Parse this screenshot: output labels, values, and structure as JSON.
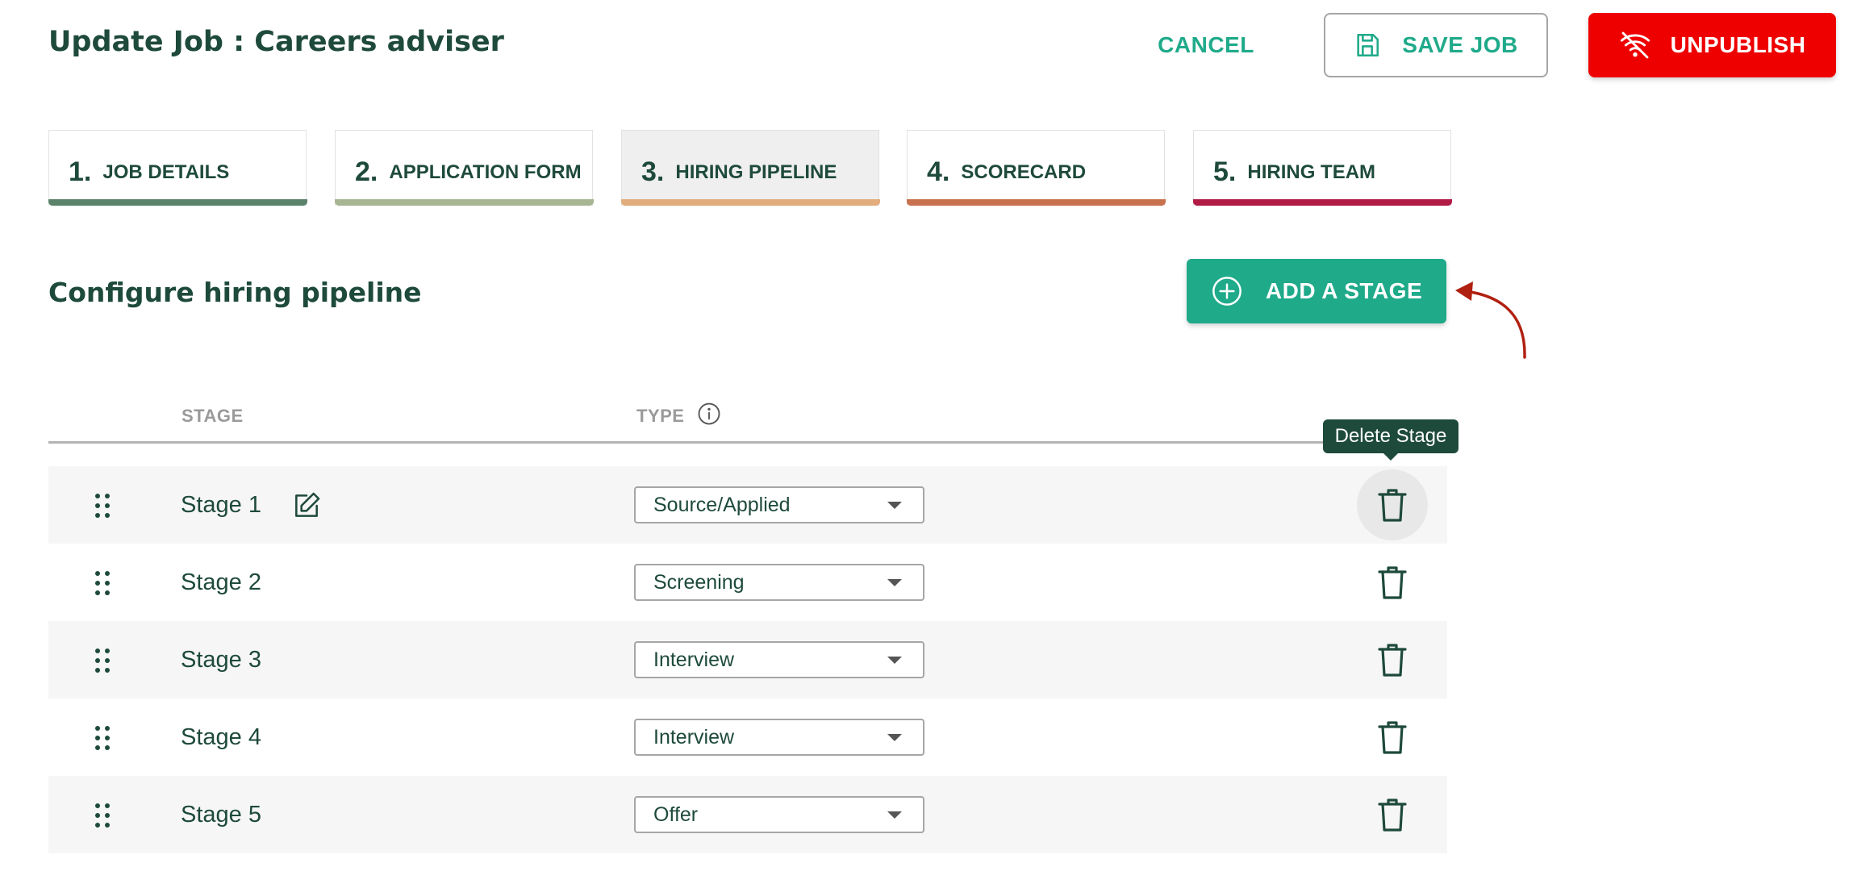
{
  "header": {
    "title": "Update Job : Careers adviser",
    "cancel_label": "CANCEL",
    "save_label": "SAVE JOB",
    "unpublish_label": "UNPUBLISH"
  },
  "tabs": [
    {
      "number": "1.",
      "label": "JOB DETAILS",
      "bar_color": "#5b826b",
      "active": false
    },
    {
      "number": "2.",
      "label": "APPLICATION FORM",
      "bar_color": "#a7b593",
      "active": false
    },
    {
      "number": "3.",
      "label": "HIRING PIPELINE",
      "bar_color": "#e2ac7d",
      "active": true
    },
    {
      "number": "4.",
      "label": "SCORECARD",
      "bar_color": "#c8714f",
      "active": false
    },
    {
      "number": "5.",
      "label": "HIRING TEAM",
      "bar_color": "#b31b47",
      "active": false
    }
  ],
  "pipeline": {
    "title": "Configure hiring pipeline",
    "add_stage_label": "ADD A STAGE",
    "columns": {
      "stage": "STAGE",
      "type": "TYPE"
    },
    "tooltip": "Delete Stage",
    "stages": [
      {
        "name": "Stage 1",
        "type": "Source/Applied"
      },
      {
        "name": "Stage 2",
        "type": "Screening"
      },
      {
        "name": "Stage 3",
        "type": "Interview"
      },
      {
        "name": "Stage 4",
        "type": "Interview"
      },
      {
        "name": "Stage 5",
        "type": "Offer"
      }
    ]
  },
  "icons": {
    "save": "floppy-disk-icon",
    "unpublish": "wifi-off-icon",
    "add_stage": "plus-circle-icon",
    "type_info": "info-icon",
    "drag": "drag-handle-icon",
    "edit": "edit-icon",
    "delete": "trash-icon",
    "annotation": "curved-arrow-icon"
  },
  "colors": {
    "brand_dark": "#1e4a3b",
    "accent_teal": "#1faa8a",
    "danger_red": "#ef0000",
    "annotation_red": "#b02010"
  }
}
